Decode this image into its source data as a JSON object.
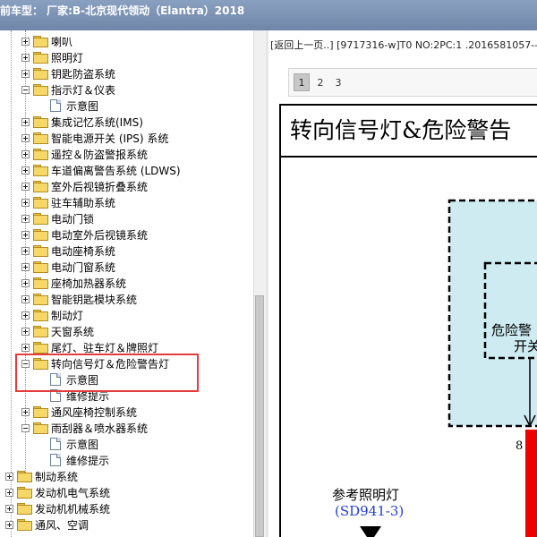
{
  "window": {
    "title": "前车型： 厂家:B-北京现代领动（Elantra）2018"
  },
  "tree": {
    "items": [
      {
        "label": "喇叭",
        "kind": "folder",
        "expander": "plus"
      },
      {
        "label": "照明灯",
        "kind": "folder",
        "expander": "plus"
      },
      {
        "label": "钥匙防盗系统",
        "kind": "folder",
        "expander": "plus"
      },
      {
        "label": "指示灯＆仪表",
        "kind": "folder",
        "expander": "minus"
      },
      {
        "label": "示意图",
        "kind": "doc"
      },
      {
        "label": "集成记忆系统(IMS)",
        "kind": "folder",
        "expander": "plus"
      },
      {
        "label": "智能电源开关 (IPS) 系统",
        "kind": "folder",
        "expander": "plus"
      },
      {
        "label": "遥控＆防盗警报系统",
        "kind": "folder",
        "expander": "plus"
      },
      {
        "label": "车道偏离警告系统 (LDWS)",
        "kind": "folder",
        "expander": "plus"
      },
      {
        "label": "室外后视镜折叠系统",
        "kind": "folder",
        "expander": "plus"
      },
      {
        "label": "驻车辅助系统",
        "kind": "folder",
        "expander": "plus"
      },
      {
        "label": "电动门锁",
        "kind": "folder",
        "expander": "plus"
      },
      {
        "label": "电动室外后视镜系统",
        "kind": "folder",
        "expander": "plus"
      },
      {
        "label": "电动座椅系统",
        "kind": "folder",
        "expander": "plus"
      },
      {
        "label": "电动门窗系统",
        "kind": "folder",
        "expander": "plus"
      },
      {
        "label": "座椅加热器系统",
        "kind": "folder",
        "expander": "plus"
      },
      {
        "label": "智能钥匙模块系统",
        "kind": "folder",
        "expander": "plus"
      },
      {
        "label": "制动灯",
        "kind": "folder",
        "expander": "plus"
      },
      {
        "label": "天窗系统",
        "kind": "folder",
        "expander": "plus"
      },
      {
        "label": "尾灯、驻车灯＆牌照灯",
        "kind": "folder",
        "expander": "plus"
      },
      {
        "label": "转向信号灯＆危险警告灯",
        "kind": "folder",
        "expander": "minus"
      },
      {
        "label": "示意图",
        "kind": "doc"
      },
      {
        "label": "维修提示",
        "kind": "doc"
      },
      {
        "label": "通风座椅控制系统",
        "kind": "folder",
        "expander": "plus"
      },
      {
        "label": "雨刮器＆喷水器系统",
        "kind": "folder",
        "expander": "minus"
      },
      {
        "label": "示意图",
        "kind": "doc"
      },
      {
        "label": "维修提示",
        "kind": "doc"
      },
      {
        "label": "制动系统",
        "kind": "folder",
        "expander": "plus"
      },
      {
        "label": "发动机电气系统",
        "kind": "folder",
        "expander": "plus"
      },
      {
        "label": "发动机机械系统",
        "kind": "folder",
        "expander": "plus"
      },
      {
        "label": "通风、空调",
        "kind": "folder",
        "expander": "plus"
      }
    ]
  },
  "viewer": {
    "breadcrumb": "[返回上一页..] [9717316-w]T0 NO:2PC:1 .2016581057--",
    "pages": [
      "1",
      "2",
      "3"
    ],
    "active_page": "1",
    "doc_title": "转向信号灯&危险警告",
    "diagram": {
      "switch_label_line1": "危险警",
      "switch_label_line2": "开关",
      "pin_number": "8",
      "ref_label": "参考照明灯",
      "ref_code": "(SD941-3)"
    }
  },
  "colors": {
    "highlight": "#e43b3b",
    "box_fill": "#cdebf1",
    "wire_red": "#ee0000"
  }
}
